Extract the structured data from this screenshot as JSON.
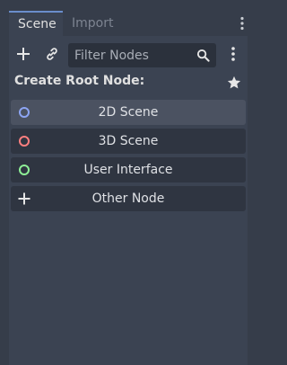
{
  "tabs": [
    {
      "label": "Scene",
      "active": true
    },
    {
      "label": "Import",
      "active": false
    }
  ],
  "toolbar": {
    "add_icon": "plus-icon",
    "link_icon": "link-icon",
    "filter": {
      "placeholder": "Filter Nodes",
      "value": ""
    },
    "menu_icon": "vertical-dots-icon"
  },
  "create_root": {
    "header": "Create Root Node:",
    "favorite_icon": "star-icon"
  },
  "root_nodes": [
    {
      "label": "2D Scene",
      "icon": "circle-icon",
      "color": "#8da5f3"
    },
    {
      "label": "3D Scene",
      "icon": "circle-icon",
      "color": "#fc7f7f"
    },
    {
      "label": "User Interface",
      "icon": "circle-icon",
      "color": "#8eef97"
    },
    {
      "label": "Other Node",
      "icon": "plus-icon",
      "color": "#e0e0e0"
    }
  ],
  "colors": {
    "background": "#363d4a",
    "panel": "#3b4352",
    "button": "#2f3541",
    "button_hover": "#4b5261",
    "tab_accent": "#6a8dcb"
  }
}
